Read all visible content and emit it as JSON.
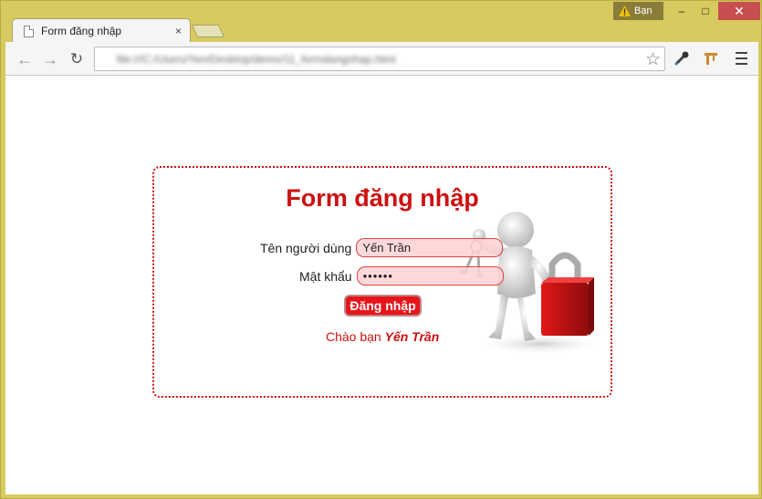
{
  "window": {
    "user_badge": "Bạn",
    "minimize": "–",
    "maximize": "□",
    "close": "✕"
  },
  "tab": {
    "title": "Form đăng nhập",
    "close": "×"
  },
  "toolbar": {
    "back": "←",
    "forward": "→",
    "reload": "↻",
    "url": "file:///C:/Users/Yen/Desktop/demo/11_formdangnhap.html",
    "star": "☆"
  },
  "page": {
    "form_title": "Form đăng nhập",
    "username_label": "Tên người dùng",
    "username_value": "Yến Trần",
    "password_label": "Mật khẩu",
    "password_value": "••••••",
    "submit_label": "Đăng nhập",
    "greeting_prefix": "Chào bạn",
    "greeting_name": "Yến Trần"
  },
  "colors": {
    "accent": "#cc1111",
    "frame": "#d7ca5e",
    "field_bg": "#ffd2d2"
  },
  "icons": [
    "warning-icon",
    "page-icon",
    "back-arrow-icon",
    "forward-arrow-icon",
    "reload-icon",
    "star-icon",
    "eyedropper-icon",
    "extension-icon",
    "menu-icon",
    "figure-with-keys-and-lock"
  ]
}
